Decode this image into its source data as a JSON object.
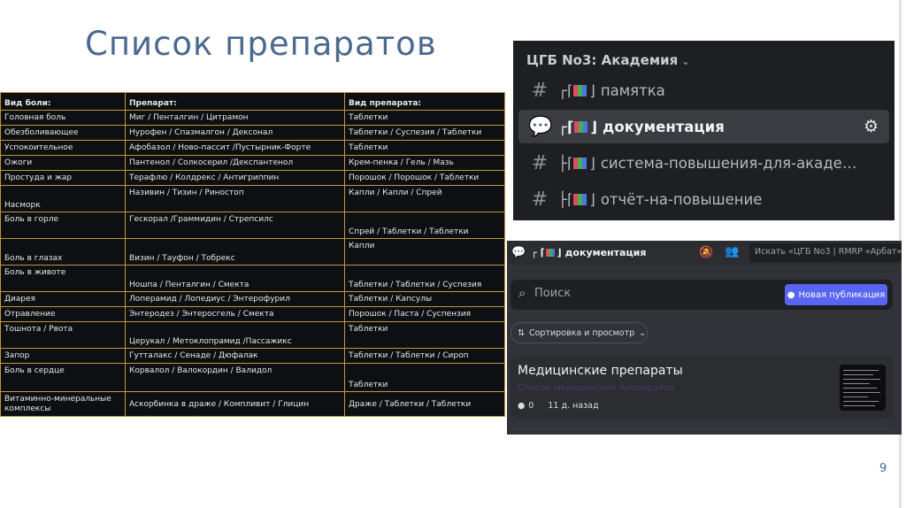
{
  "slide": {
    "title": "Список препаратов",
    "page_number": "9"
  },
  "table": {
    "headers": [
      "Вид боли:",
      "Препарат:",
      "Вид препарата:"
    ],
    "rows": [
      [
        "Головная боль",
        "Миг / Пенталгин / Цитрамон",
        "Таблетки"
      ],
      [
        "Обезболивающее",
        "Нурофен / Спазмалгон / Дексонал",
        "Таблетки / Суспезия / Таблетки"
      ],
      [
        "Успокоительное",
        "Афобазол / Ново-пассит /Пустырник-Форте",
        "Таблетки"
      ],
      [
        "Ожоги",
        "Пантенол / Солкосерил /Декспантенол",
        "Крем-пенка / Гель / Мазь"
      ],
      [
        "Простуда и жар",
        "Терафлю / Колдрекс / Антигриппин",
        "Порошок / Порошок / Таблетки"
      ],
      [
        "Насморк",
        "Називин / Тизин / Риностоп",
        "Капли / Капли / Спрей"
      ],
      [
        "Боль в горле",
        "Гескорал /Граммидин / Стрепсилс",
        "Спрей / Таблетки / Таблетки"
      ],
      [
        "Боль в глазах",
        "Визин / Тауфон / Тобрекс",
        "Капли"
      ],
      [
        "Боль в животе",
        "Ношпа / Пенталгин / Смекта",
        "Таблетки / Таблетки / Суспезия"
      ],
      [
        "Диарея",
        "Лоперамид / Лопедиус / Энтерофурил",
        "Таблетки / Капсулы"
      ],
      [
        "Отравление",
        "Энтеродез / Энтеросгель / Смекта",
        "Порошок / Паста / Суспензия"
      ],
      [
        "Тошнота / Рвота",
        "Церукал / Метоклопрамид /Пассажикс",
        "Таблетки"
      ],
      [
        "Запор",
        "Гутталакс / Сенаде / Дюфалак",
        "Таблетки / Таблетки / Сироп"
      ],
      [
        "Боль в сердце",
        "Корвалол / Валокордин / Валидол",
        "Таблетки"
      ],
      [
        "Витаминно-минеральные комплексы",
        "Аскорбинка в драже / Компливит / Глицин",
        "Драже / Таблетки / Таблетки"
      ]
    ]
  },
  "channels": {
    "server_name": "ЦГБ No3: Академия",
    "items": [
      {
        "prefix": "┌",
        "name": "памятка",
        "icon": "hash-lock-icon",
        "active": false
      },
      {
        "prefix": "┌",
        "name": "документация",
        "icon": "forum-lock-icon",
        "active": true
      },
      {
        "prefix": "├",
        "name": "система-повышения-для-академии",
        "icon": "hash-lock-icon",
        "active": false
      },
      {
        "prefix": "├",
        "name": "отчёт-на-повышение",
        "icon": "hash-lock-icon",
        "active": false
      }
    ]
  },
  "forum": {
    "channel_prefix": "┌",
    "channel_name": "документация",
    "search_placeholder": "Искать «ЦГБ No3 | RMRP «Арбат»»",
    "filter_placeholder": "Поиск",
    "new_post_label": "Новая публикация",
    "sort_label": "Сортировка и просмотр",
    "post": {
      "title": "Медицинские препараты",
      "subtitle": "Список медицинских препаратов",
      "comments": "0",
      "age": "11 д. назад"
    }
  },
  "colors": {
    "accent": "#5865f2",
    "title": "#4a6a8e",
    "table_border": "#b89a3a"
  }
}
